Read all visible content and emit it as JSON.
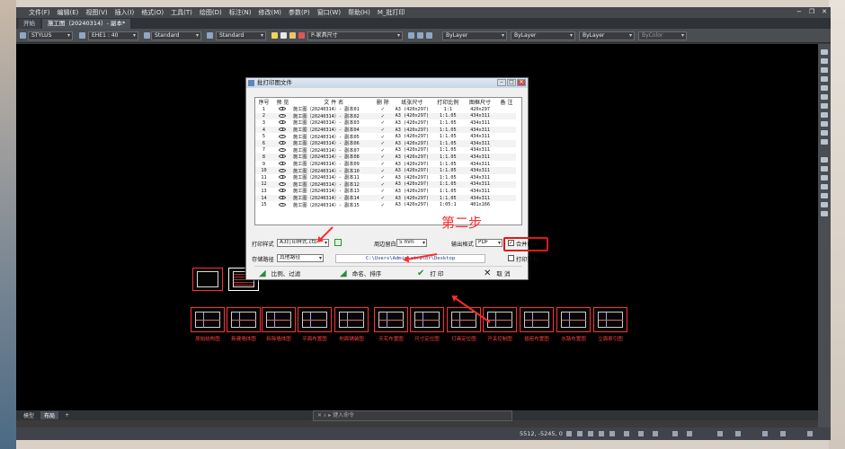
{
  "menubar": {
    "items": [
      "文件(F)",
      "编辑(E)",
      "视图(V)",
      "插入(I)",
      "格式(O)",
      "工具(T)",
      "绘图(D)",
      "标注(N)",
      "修改(M)",
      "参数(P)",
      "窗口(W)",
      "帮助(H)",
      "M_批打印"
    ]
  },
  "tabs": [
    {
      "label": "开始"
    },
    {
      "label": "施工图（20240314）- 副本*"
    }
  ],
  "toolbar": {
    "workspace": "STYLUS",
    "scale": "EHE1 : 40",
    "text_style": "Standard",
    "dim_style": "Standard",
    "layer": "P-家具尺寸",
    "color": "ByLayer",
    "linetype": "ByLayer",
    "lineweight": "ByLayer",
    "plotstyle": "ByColor"
  },
  "dialog": {
    "title": "批打印图文件",
    "columns": [
      "序号",
      "预 览",
      "文 件 名",
      "删 除",
      "纸张尺寸",
      "打印比例",
      "图框尺寸",
      "备 注"
    ],
    "rows": [
      {
        "no": "1",
        "name": "施工图（20240314）- 副本01",
        "paper": "A3 (420x297)",
        "scale": "1:1",
        "frame": "420x297"
      },
      {
        "no": "2",
        "name": "施工图（20240314）- 副本02",
        "paper": "A3 (420x297)",
        "scale": "1:1.05",
        "frame": "434x311"
      },
      {
        "no": "3",
        "name": "施工图（20240314）- 副本03",
        "paper": "A3 (420x297)",
        "scale": "1:1.05",
        "frame": "434x311"
      },
      {
        "no": "4",
        "name": "施工图（20240314）- 副本04",
        "paper": "A3 (420x297)",
        "scale": "1:1.05",
        "frame": "434x311"
      },
      {
        "no": "5",
        "name": "施工图（20240314）- 副本05",
        "paper": "A3 (420x297)",
        "scale": "1:1.05",
        "frame": "434x311"
      },
      {
        "no": "6",
        "name": "施工图（20240314）- 副本06",
        "paper": "A3 (420x297)",
        "scale": "1:1.05",
        "frame": "434x311"
      },
      {
        "no": "7",
        "name": "施工图（20240314）- 副本07",
        "paper": "A3 (420x297)",
        "scale": "1:1.05",
        "frame": "434x311"
      },
      {
        "no": "8",
        "name": "施工图（20240314）- 副本08",
        "paper": "A3 (420x297)",
        "scale": "1:1.05",
        "frame": "434x311"
      },
      {
        "no": "9",
        "name": "施工图（20240314）- 副本09",
        "paper": "A3 (420x297)",
        "scale": "1:1.05",
        "frame": "434x311"
      },
      {
        "no": "10",
        "name": "施工图（20240314）- 副本10",
        "paper": "A3 (420x297)",
        "scale": "1:1.05",
        "frame": "434x311"
      },
      {
        "no": "11",
        "name": "施工图（20240314）- 副本11",
        "paper": "A3 (420x297)",
        "scale": "1:1.05",
        "frame": "434x311"
      },
      {
        "no": "12",
        "name": "施工图（20240314）- 副本12",
        "paper": "A3 (420x297)",
        "scale": "1:1.05",
        "frame": "434x311"
      },
      {
        "no": "13",
        "name": "施工图（20240314）- 副本13",
        "paper": "A3 (420x297)",
        "scale": "1:1.05",
        "frame": "434x311"
      },
      {
        "no": "14",
        "name": "施工图（20240314）- 副本14",
        "paper": "A3 (420x297)",
        "scale": "1:1.05",
        "frame": "434x311"
      },
      {
        "no": "15",
        "name": "施工图（20240314）- 副本15",
        "paper": "A3 (420x297)",
        "scale": "1:05:1",
        "frame": "401x166"
      }
    ],
    "print_style_label": "打印样式",
    "print_style_value": "A3打印样式.ctb",
    "margin_label": "周边留白",
    "margin_value": "5 mm",
    "output_format_label": "输出格式",
    "output_format_value": "PDF",
    "merge_pdf_label": "合并PDF",
    "save_path_label": "存储路径",
    "save_path_mode": "其他路径",
    "save_path": "C:\\Users\\Administrator\\Desktop",
    "print_sign_label": "打印签名",
    "btn_scale_filter": "比例、过滤",
    "btn_name_sort": "命名、排序",
    "btn_print": "打 印",
    "btn_cancel": "取 消"
  },
  "annotation": {
    "step_text": "第二步"
  },
  "drawings": [
    {
      "label": "原始结构图"
    },
    {
      "label": "新建墙体图"
    },
    {
      "label": "拆除墙体图"
    },
    {
      "label": "平面布置图"
    },
    {
      "label": "地面铺装图"
    },
    {
      "label": "天花布置图"
    },
    {
      "label": "尺寸定位图"
    },
    {
      "label": "灯具定位图"
    },
    {
      "label": "开关控制图"
    },
    {
      "label": "插座布置图"
    },
    {
      "label": "水路布置图"
    },
    {
      "label": "立面索引图"
    }
  ],
  "layout_tabs": [
    "模型",
    "布局"
  ],
  "command_placeholder": "键入命令",
  "status": {
    "coords": "5512, -5245, 0"
  },
  "colors": {
    "accent_red": "#e01818",
    "canvas": "#000000"
  }
}
